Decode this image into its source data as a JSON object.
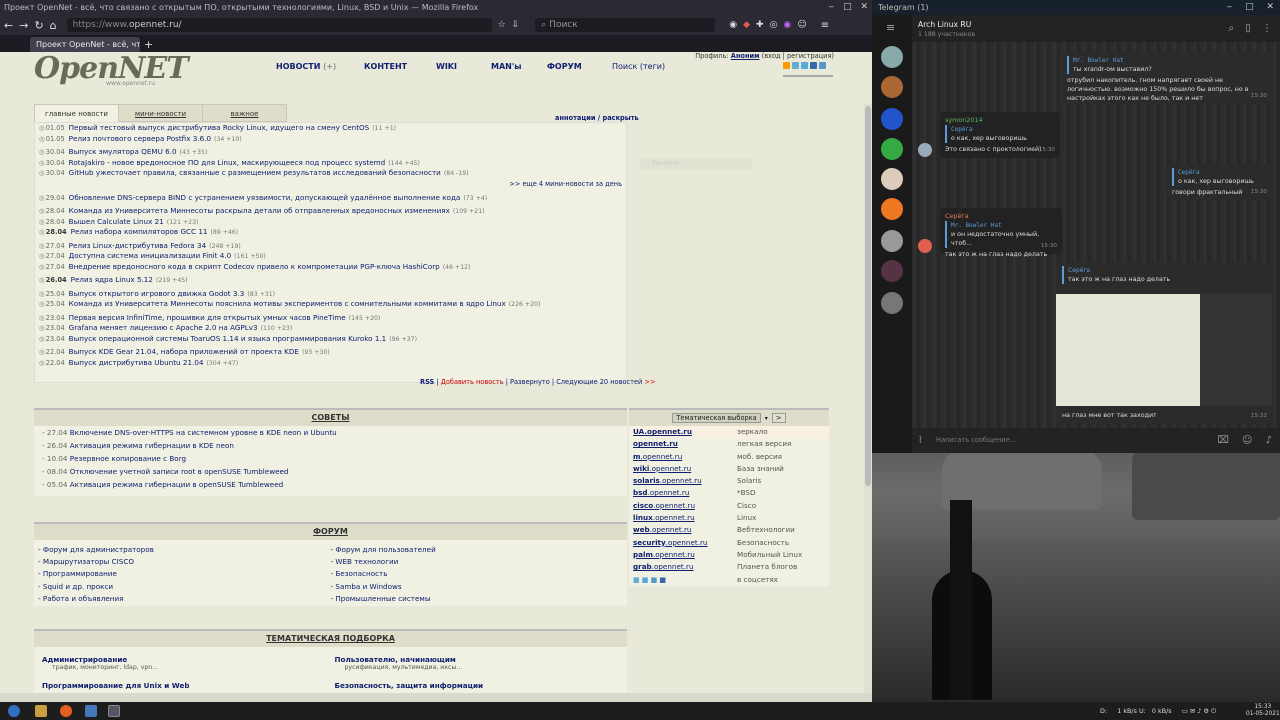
{
  "firefox": {
    "title": "Проект OpenNet - всё, что связано с открытым ПО, открытыми технологиями, Linux, BSD и Unix — Mozilla Firefox",
    "url_prefix": "https://www.",
    "url_domain": "opennet.ru/",
    "search_placeholder": "Поиск",
    "tab_label": "Проект OpenNet - всё, что"
  },
  "site": {
    "logo": "OpenNET",
    "logo_sub": "www.opennet.ru",
    "nav": [
      {
        "label": "НОВОСТИ",
        "extra": "(+)"
      },
      {
        "label": "КОНТЕНТ",
        "extra": ""
      },
      {
        "label": "WIKI",
        "extra": ""
      },
      {
        "label": "MAN'ы",
        "extra": ""
      },
      {
        "label": "ФОРУМ",
        "extra": ""
      }
    ],
    "search_link": "Поиск (теги)",
    "profile_label": "Профиль:",
    "profile_user": "Аноним",
    "profile_links": "(вход | регистрация)",
    "tabs": [
      "главные новости",
      "мини-новости",
      "важное"
    ],
    "annotations": "аннотации / раскрыть",
    "ghost": "Реклама",
    "news": [
      {
        "date": "01.05",
        "title": "Первый тестовый выпуск дистрибутива Rocky Linux, идущего на смену CentOS",
        "count": "(11 +1)",
        "bold": false
      },
      {
        "date": "01.05",
        "title": "Релиз почтового сервера Postfix 3.6.0",
        "count": "(34 +10)",
        "bold": false
      },
      {
        "date": "30.04",
        "title": "Выпуск эмулятора QEMU 6.0",
        "count": "(43 +35)",
        "bold": false,
        "sep": true
      },
      {
        "date": "30.04",
        "title": "RotaJakiro - новое вредоносное ПО для Linux, маскирующееся под процесс systemd",
        "count": "(144 +45)",
        "bold": false
      },
      {
        "date": "30.04",
        "title": "GitHub ужесточает правила, связанные с размещением результатов исследований безопасности",
        "count": "(84 -19)",
        "bold": false
      }
    ],
    "more_mini": ">> еще 4 мини-новости за день",
    "news2": [
      {
        "date": "29.04",
        "title": "Обновление DNS-сервера BIND с устранением уязвимости, допускающей удалённое выполнение кода",
        "count": "(73 +4)",
        "bold": false
      },
      {
        "date": "28.04",
        "title": "Команда из Университета Миннесоты раскрыла детали об отправленных вредоносных изменениях",
        "count": "(109 +21)",
        "bold": false,
        "sep": true
      },
      {
        "date": "28.04",
        "title": "Вышел Calculate Linux 21",
        "count": "(121 +23)",
        "bold": false
      },
      {
        "date": "28.04",
        "title": "Релиз набора компиляторов GCC 11",
        "count": "(89 +46)",
        "bold": true
      },
      {
        "date": "27.04",
        "title": "Релиз Linux-дистрибутива Fedora 34",
        "count": "(248 +19)",
        "bold": false,
        "sep": true
      },
      {
        "date": "27.04",
        "title": "Доступна система инициализации Finit 4.0",
        "count": "(161 +50)",
        "bold": false
      },
      {
        "date": "27.04",
        "title": "Внедрение вредоносного кода в скрипт Codecov привело к компрометации PGP-ключа HashiCorp",
        "count": "(46 +12)",
        "bold": false
      },
      {
        "date": "26.04",
        "title": "Релиз ядра Linux 5.12",
        "count": "(219 +45)",
        "bold": true,
        "sep": true
      },
      {
        "date": "25.04",
        "title": "Выпуск открытого игрового движка Godot 3.3",
        "count": "(83 +31)",
        "bold": false,
        "sep": true
      },
      {
        "date": "25.04",
        "title": "Команда из Университета Миннесоты пояснила мотивы экспериментов с сомнительными коммитами в ядро Linux",
        "count": "(226 +20)",
        "bold": false
      },
      {
        "date": "23.04",
        "title": "Первая версия InfiniTime, прошивки для открытых умных часов PineTime",
        "count": "(145 +20)",
        "bold": false,
        "sep": true
      },
      {
        "date": "23.04",
        "title": "Grafana меняет лицензию с Apache 2.0 на AGPLv3",
        "count": "(110 +23)",
        "bold": false
      },
      {
        "date": "23.04",
        "title": "Выпуск операционной системы ToaruOS 1.14 и языка программирования Kuroko 1.1",
        "count": "(96 +37)",
        "bold": false
      },
      {
        "date": "22.04",
        "title": "Выпуск KDE Gear 21.04, набора приложений от проекта KDE",
        "count": "(93 +30)",
        "bold": false,
        "sep": true
      },
      {
        "date": "22.04",
        "title": "Выпуск дистрибутива Ubuntu 21.04",
        "count": "(304 +47)",
        "bold": false
      }
    ],
    "rss": {
      "rss": "RSS",
      "add": "Добавить новость",
      "expand": "Развернуто",
      "next": "Следующие 20 новостей",
      "arrows": ">>"
    },
    "tips_title": "СОВЕТЫ",
    "tips": [
      {
        "date": "- 27.04",
        "title": "Включение DNS-over-HTTPS на системном уровне в KDE neon и Ubuntu"
      },
      {
        "date": "- 26.04",
        "title": "Активация режима гибернации в KDE neon"
      },
      {
        "date": "- 10.04",
        "title": "Резервное копирование с Borg"
      },
      {
        "date": "- 08.04",
        "title": "Отключение учетной записи root в openSUSE Tumbleweed"
      },
      {
        "date": "- 05.04",
        "title": "Активация режима гибернации в openSUSE Tumbleweed"
      }
    ],
    "forum_title": "ФОРУМ",
    "forum_left": [
      "- Форум для администраторов",
      "- Маршрутизаторы CISCO",
      "- Программирование",
      "- Squid и др. прокси",
      "- Работа и объявления"
    ],
    "forum_right": [
      "- Форум для пользователей",
      "- WEB технологии",
      "- Безопасность",
      "- Samba и Windows",
      "- Промышленные системы"
    ],
    "thema_title": "ТЕМАТИЧЕСКАЯ ПОДБОРКА",
    "thema": [
      {
        "title": "Администрирование",
        "sub": "трафик, мониторинг, ldap, vpn..."
      },
      {
        "title": "Пользователю, начинающим",
        "sub": "русификация, мультимедиа, иксы..."
      },
      {
        "title": "Программирование для Unix и Web",
        "sub": ""
      },
      {
        "title": "Безопасность, защита информации",
        "sub": ""
      }
    ],
    "mirror_select": "Тематическая выборка",
    "mirror_btn": ">",
    "mirrors": [
      {
        "host": "UA.opennet.ru",
        "rest": "",
        "label": "зеркало"
      },
      {
        "host": "opennet.ru",
        "rest": "",
        "label": "легкая версия"
      },
      {
        "host": "m",
        "rest": ".opennet.ru",
        "label": "моб. версия"
      },
      {
        "host": "wiki",
        "rest": ".opennet.ru",
        "label": "База знаний"
      },
      {
        "host": "solaris",
        "rest": ".opennet.ru",
        "label": "Solaris"
      },
      {
        "host": "bsd",
        "rest": ".opennet.ru",
        "label": "*BSD"
      },
      {
        "host": "cisco",
        "rest": ".opennet.ru",
        "label": "Cisco"
      },
      {
        "host": "linux",
        "rest": ".opennet.ru",
        "label": "Linux"
      },
      {
        "host": "web",
        "rest": ".opennet.ru",
        "label": "Вебтехнологии"
      },
      {
        "host": "security",
        "rest": ".opennet.ru",
        "label": "Безопасность"
      },
      {
        "host": "palm",
        "rest": ".opennet.ru",
        "label": "Мобильный Linux"
      },
      {
        "host": "grab",
        "rest": ".opennet.ru",
        "label": "Планета блогов"
      },
      {
        "host": "",
        "rest": "",
        "label": "в соцсетях"
      }
    ]
  },
  "telegram": {
    "title": "Telegram (1)",
    "chat_name": "Arch Linux RU",
    "members": "1 188 участников",
    "input_placeholder": "Написать сообщение...",
    "messages": [
      {
        "quote_name": "Mr. Bowler Hat",
        "quote_text": "ты xrandr-ом выставил?",
        "text": "отрубил накопитель. гном напрягает своей не логичностью. возможно 150% решило бы вопрос, но в настройках этого как не было, так и нет",
        "time": "15:30"
      },
      {
        "author": "symon2014",
        "quote_name": "Серёга",
        "quote_text": "о как, хер выговоришь",
        "text": "Это связано с проктологией)",
        "time": "15:30"
      },
      {
        "quote_name": "Серёга",
        "quote_text": "о как, хер выговоришь",
        "text": "говори фрактальный",
        "time": "15:30"
      },
      {
        "author": "Серёга",
        "quote_name": "Mr. Bowler Hat",
        "quote_text": "и он недостаточно умный, чтоб...",
        "text": "так это ж на глаз надо делать",
        "time": "15:30"
      },
      {
        "quote_name": "Серёга",
        "quote_text": "так это ж на глаз надо делать",
        "text": "на глаз мне вот так заходит",
        "time": "15:32"
      }
    ]
  },
  "taskbar": {
    "net_label": "D:",
    "net_down": "1 kB/s",
    "net_up_label": "U:",
    "net_up": "0 kB/s",
    "time": "15:33",
    "date": "01-05-2021"
  }
}
